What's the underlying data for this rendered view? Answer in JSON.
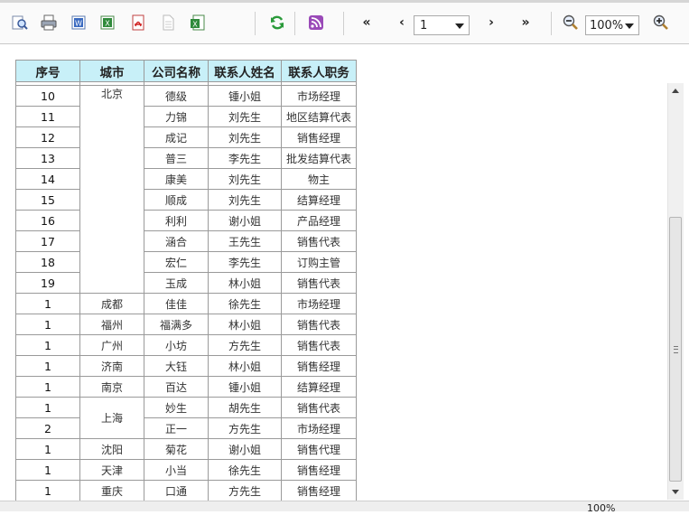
{
  "toolbar": {
    "buttons": [
      "find-icon",
      "print-icon",
      "export-word-icon",
      "export-excel-icon",
      "export-pdf-icon",
      "export-text-icon",
      "export-csv-icon",
      "refresh-icon",
      "rss-icon"
    ],
    "first_label": "«",
    "prev_label": "‹",
    "page_value": "1",
    "next_label": "›",
    "last_label": "»",
    "zoom_value": "100%"
  },
  "table": {
    "headers": [
      "序号",
      "城市",
      "公司名称",
      "联系人姓名",
      "联系人职务"
    ],
    "rows": [
      {
        "no": "10",
        "city": "北京",
        "company": "德级",
        "contact": "锺小姐",
        "title": "市场经理"
      },
      {
        "no": "11",
        "city": "",
        "company": "力锦",
        "contact": "刘先生",
        "title": "地区结算代表"
      },
      {
        "no": "12",
        "city": "",
        "company": "成记",
        "contact": "刘先生",
        "title": "销售经理"
      },
      {
        "no": "13",
        "city": "",
        "company": "普三",
        "contact": "李先生",
        "title": "批发结算代表"
      },
      {
        "no": "14",
        "city": "",
        "company": "康美",
        "contact": "刘先生",
        "title": "物主"
      },
      {
        "no": "15",
        "city": "",
        "company": "顺成",
        "contact": "刘先生",
        "title": "结算经理"
      },
      {
        "no": "16",
        "city": "",
        "company": "利利",
        "contact": "谢小姐",
        "title": "产品经理"
      },
      {
        "no": "17",
        "city": "",
        "company": "涵合",
        "contact": "王先生",
        "title": "销售代表"
      },
      {
        "no": "18",
        "city": "",
        "company": "宏仁",
        "contact": "李先生",
        "title": "订购主管"
      },
      {
        "no": "19",
        "city": "",
        "company": "玉成",
        "contact": "林小姐",
        "title": "销售代表"
      },
      {
        "no": "1",
        "city": "成都",
        "company": "佳佳",
        "contact": "徐先生",
        "title": "市场经理"
      },
      {
        "no": "1",
        "city": "福州",
        "company": "福满多",
        "contact": "林小姐",
        "title": "销售代表"
      },
      {
        "no": "1",
        "city": "广州",
        "company": "小坊",
        "contact": "方先生",
        "title": "销售代表"
      },
      {
        "no": "1",
        "city": "济南",
        "company": "大钰",
        "contact": "林小姐",
        "title": "销售经理"
      },
      {
        "no": "1",
        "city": "南京",
        "company": "百达",
        "contact": "锺小姐",
        "title": "结算经理"
      },
      {
        "no": "1",
        "city": "上海",
        "company": "妙生",
        "contact": "胡先生",
        "title": "销售代表"
      },
      {
        "no": "2",
        "city": "",
        "company": "正一",
        "contact": "方先生",
        "title": "市场经理"
      },
      {
        "no": "1",
        "city": "沈阳",
        "company": "菊花",
        "contact": "谢小姐",
        "title": "销售代理"
      },
      {
        "no": "1",
        "city": "天津",
        "company": "小当",
        "contact": "徐先生",
        "title": "销售经理"
      },
      {
        "no": "1",
        "city": "重庆",
        "company": "口通",
        "contact": "方先生",
        "title": "销售经理"
      }
    ]
  },
  "statusbar": {
    "zoom_text": "100%"
  }
}
